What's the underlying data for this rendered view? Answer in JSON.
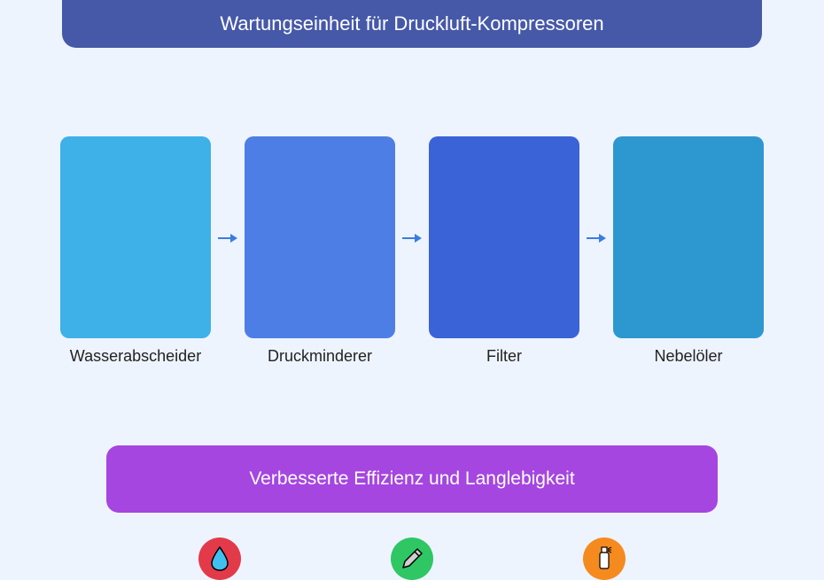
{
  "header": {
    "title": "Wartungseinheit für Druckluft-Kompressoren"
  },
  "flow": {
    "items": [
      {
        "label": "Wasserabscheider"
      },
      {
        "label": "Druckminderer"
      },
      {
        "label": "Filter"
      },
      {
        "label": "Nebelöler"
      }
    ]
  },
  "result": {
    "title": "Verbesserte Effizienz und Langlebigkeit"
  },
  "icons": [
    {
      "name": "drop-icon",
      "color": "red"
    },
    {
      "name": "wrench-icon",
      "color": "green"
    },
    {
      "name": "spray-icon",
      "color": "orange"
    }
  ],
  "colors": {
    "header_bg": "#4659a8",
    "result_bg": "#a546e0",
    "page_bg": "#eef4fd"
  }
}
